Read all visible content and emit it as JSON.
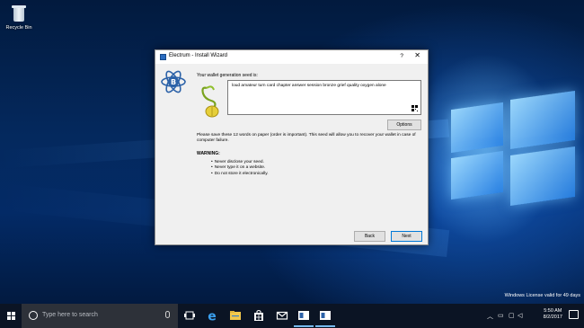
{
  "desktop": {
    "recycle_bin_label": "Recycle Bin",
    "license_text": "Windows License valid for 49 days"
  },
  "dialog": {
    "title": "Electrum  -  Install Wizard",
    "help_label": "?",
    "close_label": "✕",
    "seed_label": "Your wallet generation seed is:",
    "seed_text": "loud amateur turn card chapter answer session bronze grief quality oxygen alone",
    "options_label": "Options",
    "description": "Please save these 12 words on paper (order is important). This seed will allow you to recover your wallet in case of computer failure.",
    "warning_title": "WARNING:",
    "warnings": [
      "Never disclose your seed.",
      "Never type it on a website.",
      "Do not store it electronically."
    ],
    "back_label": "Back",
    "next_label": "Next"
  },
  "taskbar": {
    "search_placeholder": "Type here to search",
    "pinned_icons": [
      "task-view-icon",
      "edge-icon",
      "file-explorer-icon",
      "store-icon",
      "mail-icon",
      "electrum-app-icon",
      "electrum-app-icon-2"
    ],
    "clock_time": "5:50 AM",
    "clock_date": "8/2/2017"
  },
  "colors": {
    "accent": "#0078d7",
    "taskbar": "#0b1424",
    "dialog_bg": "#f0f0f0"
  }
}
